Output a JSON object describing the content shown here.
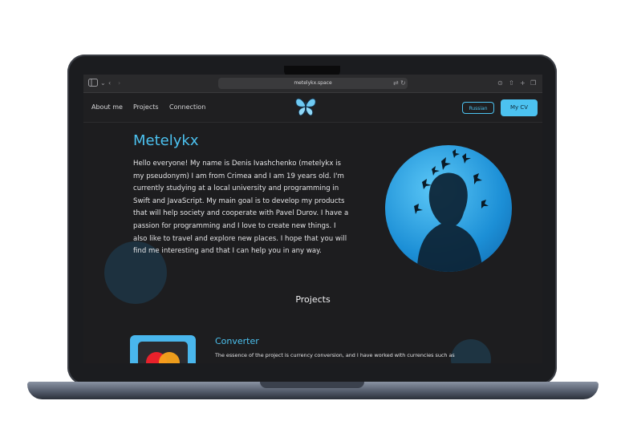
{
  "browser": {
    "url": "metelykx.space"
  },
  "nav": {
    "items": [
      {
        "label": "About me"
      },
      {
        "label": "Projects"
      },
      {
        "label": "Connection"
      }
    ],
    "russian_label": "Russian",
    "cv_label": "My CV"
  },
  "about": {
    "title": "Metelykx",
    "text": "Hello everyone! My name is Denis Ivashchenko (metelykx is my pseudonym) I am from Crimea and I am 19 years old. I'm currently studying at a local university and programming in Swift and JavaScript. My main goal is to develop my products that will help society and cooperate with Pavel Durov. I have a passion for programming and I love to create new things. I also like to travel and explore new places. I hope that you will find me interesting and that I can help you in any way."
  },
  "projects": {
    "section_title": "Projects",
    "items": [
      {
        "name": "Converter",
        "description": "The essence of the project is currency conversion, and I have worked with currencies such as"
      }
    ]
  },
  "colors": {
    "accent": "#4cc2f0",
    "background": "#1d1d1f",
    "header": "#1f1f21"
  }
}
